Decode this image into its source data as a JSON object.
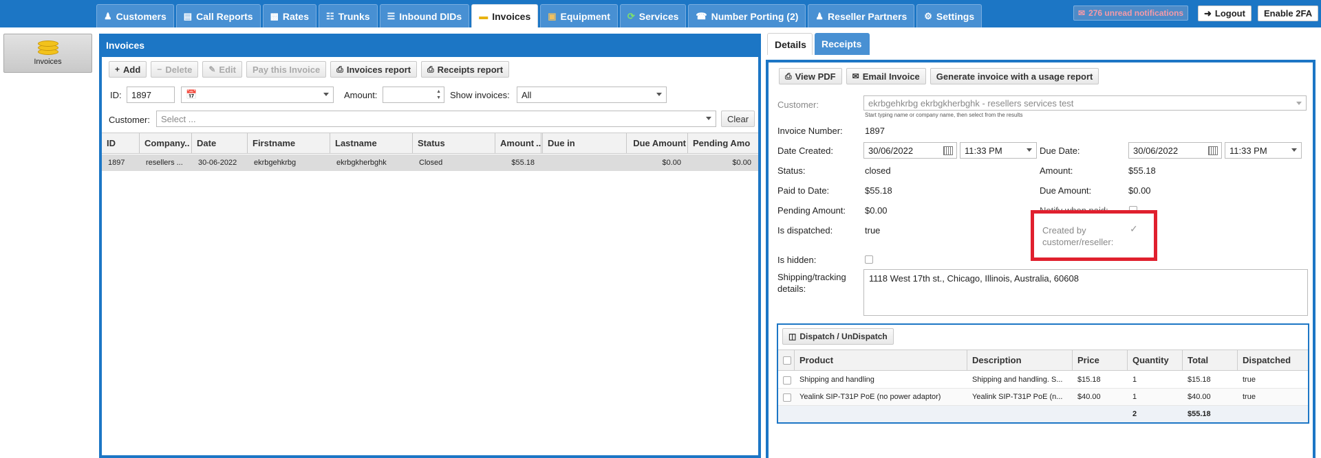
{
  "nav": {
    "tabs": [
      {
        "label": "Customers",
        "icon": "customer-icon"
      },
      {
        "label": "Call Reports",
        "icon": "report-icon"
      },
      {
        "label": "Rates",
        "icon": "rates-icon"
      },
      {
        "label": "Trunks",
        "icon": "trunk-icon"
      },
      {
        "label": "Inbound DIDs",
        "icon": "did-icon"
      },
      {
        "label": "Invoices",
        "icon": "invoice-icon",
        "active": true
      },
      {
        "label": "Equipment",
        "icon": "box-icon"
      },
      {
        "label": "Services",
        "icon": "services-icon"
      },
      {
        "label": "Number Porting (2)",
        "icon": "porting-icon"
      },
      {
        "label": "Reseller Partners",
        "icon": "partner-icon"
      },
      {
        "label": "Settings",
        "icon": "gear-icon"
      }
    ],
    "notifications": "276 unread notifications",
    "logout": "Logout",
    "enable_2fa": "Enable 2FA"
  },
  "sidebar": {
    "invoices_label": "Invoices"
  },
  "invoices_panel": {
    "title": "Invoices",
    "toolbar": {
      "add": "Add",
      "delete": "Delete",
      "edit": "Edit",
      "pay": "Pay this Invoice",
      "invoices_report": "Invoices report",
      "receipts_report": "Receipts report"
    },
    "filters": {
      "id_label": "ID:",
      "id_value": "1897",
      "amount_label": "Amount:",
      "amount_value": "",
      "show_label": "Show invoices:",
      "show_value": "All",
      "customer_label": "Customer:",
      "customer_placeholder": "Select ...",
      "clear": "Clear"
    },
    "columns": [
      "ID",
      "Company..",
      "Date",
      "Firstname",
      "Lastname",
      "Status",
      "Amount",
      "..",
      "Due in",
      "Due Amount",
      "Pending Amo"
    ],
    "rows": [
      {
        "id": "1897",
        "company": "resellers ...",
        "date": "30-06-2022",
        "firstname": "ekrbgehkrbg",
        "lastname": "ekrbgkherbghk",
        "status": "Closed",
        "amount": "$55.18",
        "due_in": "",
        "due_amount": "$0.00",
        "pending": "$0.00"
      }
    ]
  },
  "details": {
    "tabs": {
      "details": "Details",
      "receipts": "Receipts"
    },
    "toolbar": {
      "view_pdf": "View PDF",
      "email": "Email Invoice",
      "generate": "Generate invoice with a usage report"
    },
    "customer_label": "Customer:",
    "customer_value": "ekrbgehkrbg ekrbgkherbghk - resellers services test",
    "customer_hint": "Start typing name or company name, then select from the results",
    "invoice_number_label": "Invoice Number:",
    "invoice_number": "1897",
    "date_created_label": "Date Created:",
    "date_created": "30/06/2022",
    "time_created": "11:33 PM",
    "due_date_label": "Due Date:",
    "due_date": "30/06/2022",
    "due_time": "11:33 PM",
    "status_label": "Status:",
    "status": "closed",
    "amount_label": "Amount:",
    "amount": "$55.18",
    "paid_label": "Paid to Date:",
    "paid": "$55.18",
    "due_amount_label": "Due Amount:",
    "due_amount": "$0.00",
    "pending_label": "Pending Amount:",
    "pending": "$0.00",
    "notify_label": "Notify when paid:",
    "dispatched_label": "Is dispatched:",
    "dispatched": "true",
    "created_by_label": "Created by customer/reseller:",
    "created_by_checked": true,
    "hidden_label": "Is hidden:",
    "shipping_label": "Shipping/tracking details:",
    "shipping_value": "1118 West 17th st., Chicago, Illinois, Australia, 60608",
    "highlight_color": "#e0202e"
  },
  "products": {
    "dispatch_button": "Dispatch / UnDispatch",
    "columns": [
      "Product",
      "Description",
      "Price",
      "Quantity",
      "Total",
      "Dispatched"
    ],
    "rows": [
      {
        "product": "Shipping and handling",
        "description": "Shipping and handling. S...",
        "price": "$15.18",
        "quantity": "1",
        "total": "$15.18",
        "dispatched": "true"
      },
      {
        "product": "Yealink SIP-T31P PoE (no power adaptor)",
        "description": "Yealink SIP-T31P PoE (n...",
        "price": "$40.00",
        "quantity": "1",
        "total": "$40.00",
        "dispatched": "true"
      }
    ],
    "summary": {
      "quantity": "2",
      "total": "$55.18"
    }
  }
}
